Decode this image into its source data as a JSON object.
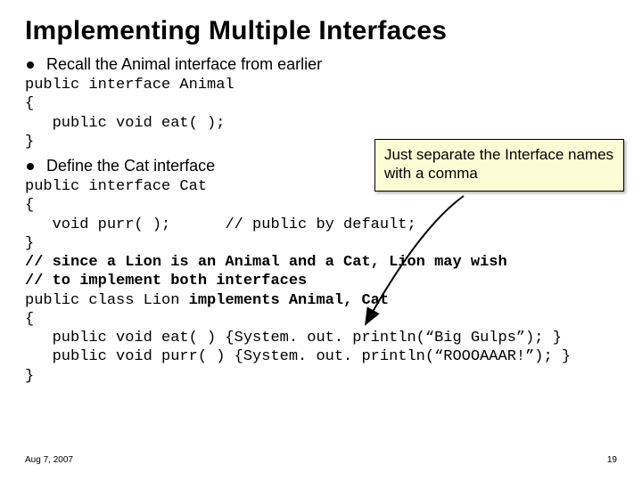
{
  "title": "Implementing Multiple Interfaces",
  "bullets": {
    "b1": "Recall the Animal interface from earlier",
    "b2": "Define the Cat interface"
  },
  "code": {
    "animal_l1": "public interface Animal",
    "animal_l2": "{",
    "animal_l3": "   public void eat( );",
    "animal_l4": "}",
    "cat_l1": "public interface Cat",
    "cat_l2": "{",
    "cat_l3_a": "   void purr( );      ",
    "cat_l3_b": "// public by default;",
    "cat_l4": "}",
    "cat_l5": "// since a Lion is an Animal and a Cat, Lion may wish",
    "cat_l6": "// to implement both interfaces",
    "cat_l7_a": "public class Lion ",
    "cat_l7_b": "implements Animal, Cat",
    "cat_l8": "{",
    "cat_l9": "   public void eat( ) {System. out. println(“Big Gulps”); }",
    "cat_l10": "   public void purr( ) {System. out. println(“ROOOAAAR!”); }",
    "cat_l11": "}"
  },
  "callout": "Just separate the Interface names with a comma",
  "footer": {
    "date": "Aug 7, 2007",
    "page": "19"
  }
}
